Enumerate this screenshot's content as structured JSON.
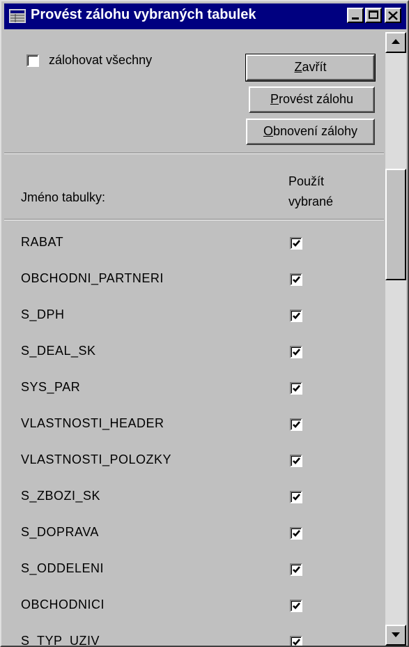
{
  "window": {
    "title": "Provést zálohu vybraných tabulek",
    "titlebar_color": "#000080"
  },
  "controls": {
    "select_all_label": "zálohovat všechny",
    "select_all_checked": false,
    "close_button": {
      "prefix": "",
      "accel": "Z",
      "rest": "avřít"
    },
    "backup_button": {
      "prefix": "",
      "accel": "P",
      "rest": "rovést zálohu"
    },
    "restore_button": {
      "prefix": "",
      "accel": "O",
      "rest": "bnovení zálohy"
    }
  },
  "table": {
    "col_name_header": "Jméno tabulky:",
    "col_use_header_line1": "Použít",
    "col_use_header_line2": "vybrané",
    "rows": [
      {
        "name": "RABAT",
        "checked": true
      },
      {
        "name": "OBCHODNI_PARTNERI",
        "checked": true
      },
      {
        "name": "S_DPH",
        "checked": true
      },
      {
        "name": "S_DEAL_SK",
        "checked": true
      },
      {
        "name": "SYS_PAR",
        "checked": true
      },
      {
        "name": "VLASTNOSTI_HEADER",
        "checked": true
      },
      {
        "name": "VLASTNOSTI_POLOZKY",
        "checked": true
      },
      {
        "name": "S_ZBOZI_SK",
        "checked": true
      },
      {
        "name": "S_DOPRAVA",
        "checked": true
      },
      {
        "name": "S_ODDELENI",
        "checked": true
      },
      {
        "name": "OBCHODNICI",
        "checked": true
      },
      {
        "name": "S_TYP_UZIV",
        "checked": true
      }
    ]
  }
}
